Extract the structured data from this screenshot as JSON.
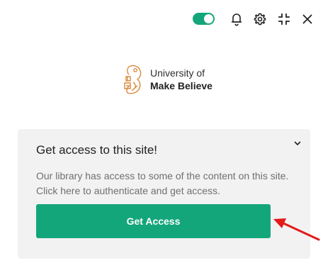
{
  "toolbar": {
    "toggle_on": true,
    "toggle_color": "#14a67b",
    "icons": [
      "toggle-switch",
      "bell-icon",
      "gear-icon",
      "minimize-icon",
      "close-icon"
    ]
  },
  "logo": {
    "line1": "University of",
    "line2": "Make Believe",
    "accent_color": "#d9893b"
  },
  "card": {
    "title": "Get access to this site!",
    "description": "Our library has access to some of the content on this site. Click here to authenticate and get access.",
    "button_label": "Get Access",
    "button_color": "#14a67b"
  },
  "annotation": {
    "arrow_color": "#e31b1b"
  }
}
